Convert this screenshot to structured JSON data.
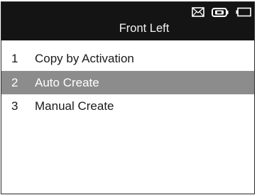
{
  "header": {
    "title": "Front Left",
    "status_icons": [
      "envelope-icon",
      "vehicle-battery-icon",
      "battery-icon"
    ]
  },
  "menu": {
    "items": [
      {
        "number": "1",
        "label": "Copy by Activation",
        "selected": false
      },
      {
        "number": "2",
        "label": "Auto Create",
        "selected": true
      },
      {
        "number": "3",
        "label": "Manual Create",
        "selected": false
      }
    ]
  },
  "colors": {
    "header_background": "#141414",
    "selected_row": "#8c8c8c",
    "text": "#1a1a1a"
  }
}
